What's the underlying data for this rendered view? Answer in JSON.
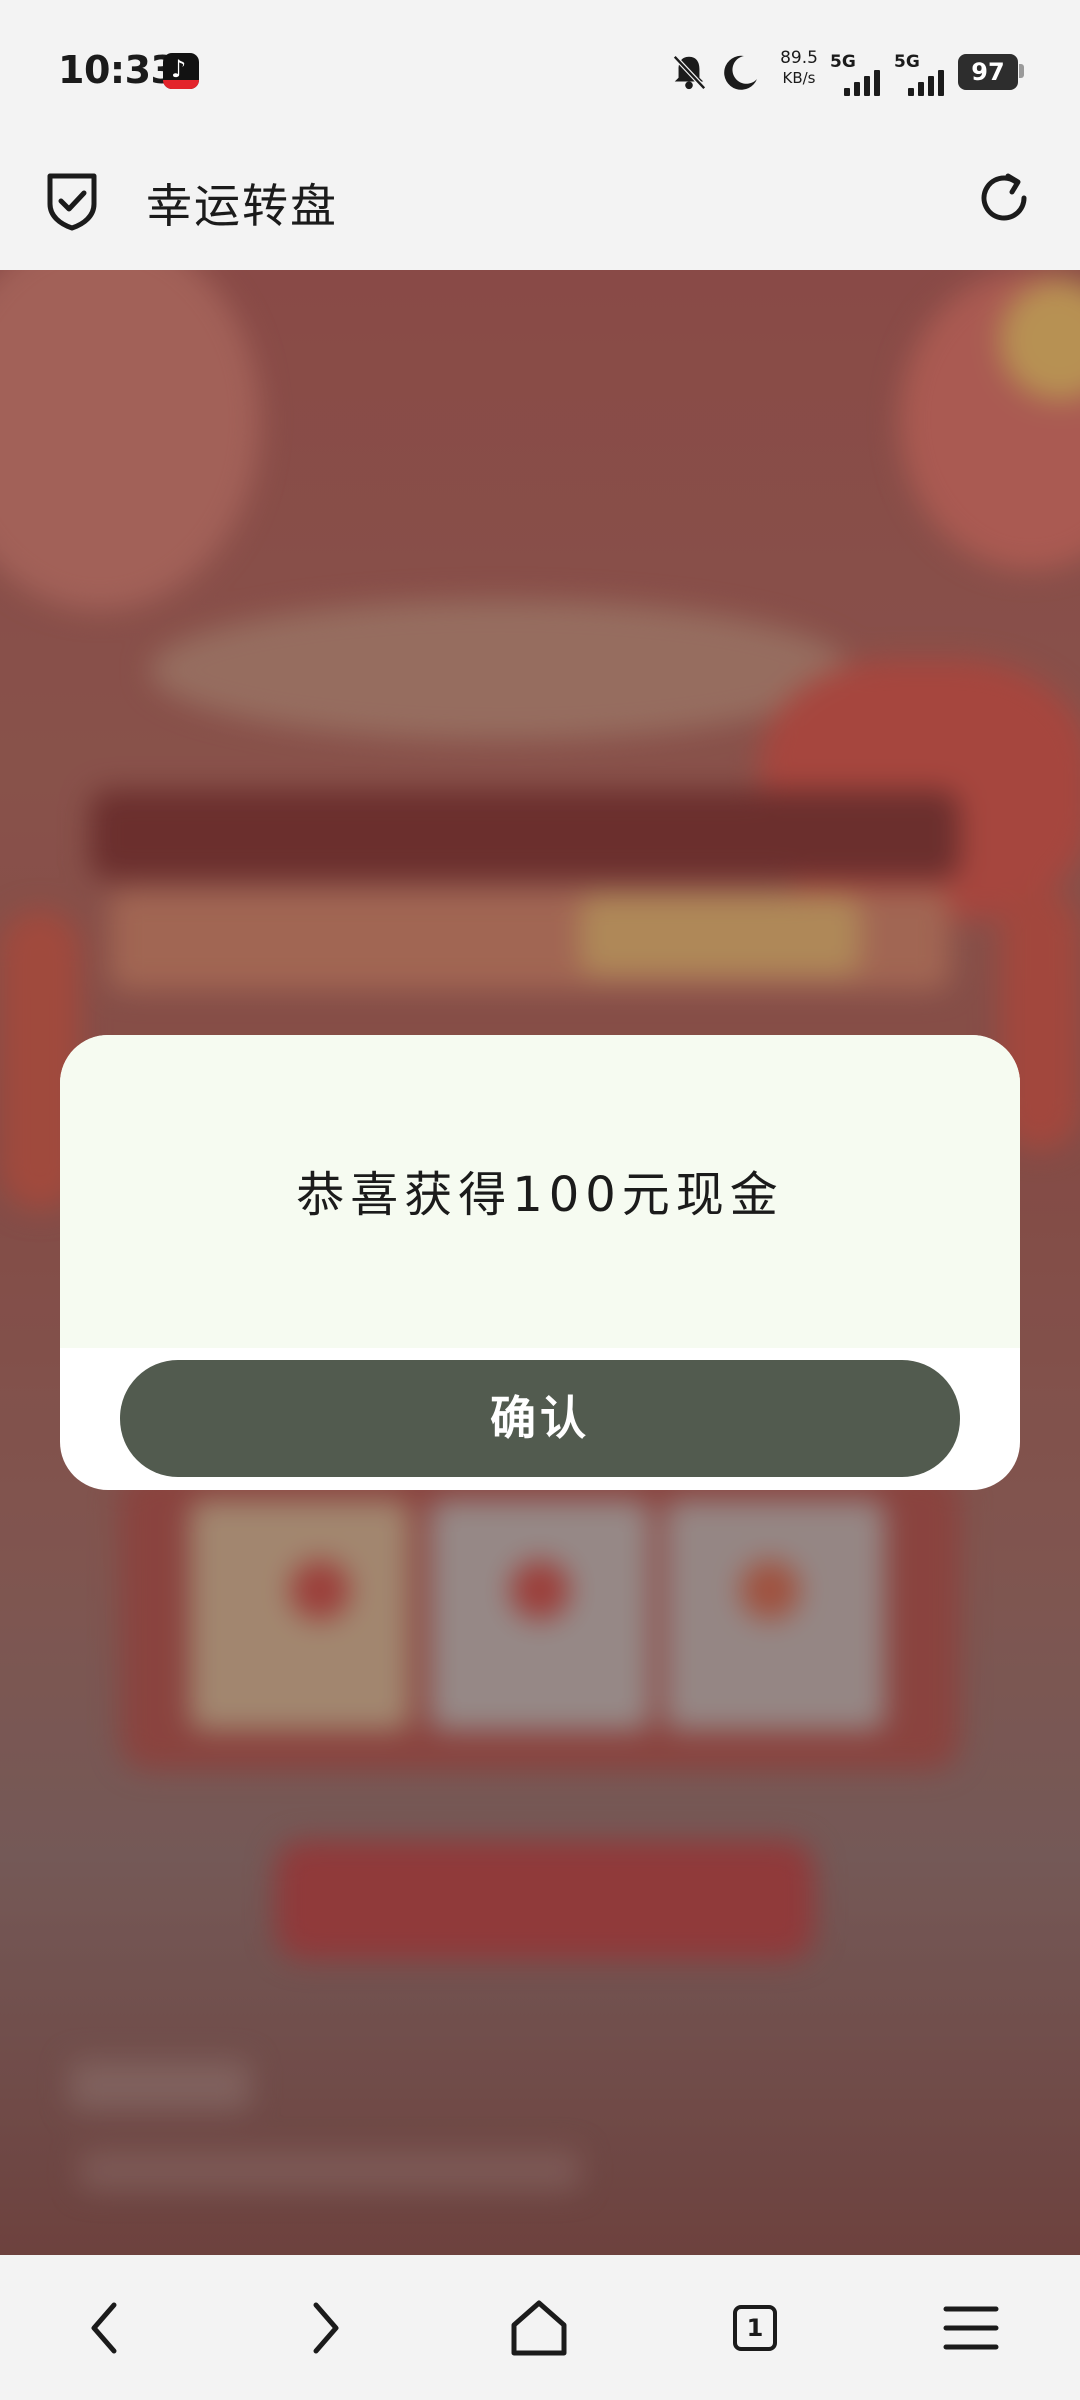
{
  "status_bar": {
    "time": "10:33",
    "net_speed_value": "89.5",
    "net_speed_unit": "KB/s",
    "signal_1_label": "5G",
    "signal_2_label": "5G",
    "battery": "97",
    "icons": [
      "tiktok-app-icon",
      "bell-muted-icon",
      "moon-icon"
    ]
  },
  "header": {
    "title": "幸运转盘",
    "left_icon": "shield-check-icon",
    "right_icon": "refresh-icon"
  },
  "dialog": {
    "message": "恭喜获得100元现金",
    "confirm_label": "确认",
    "colors": {
      "top_bg": "#f6fbf1",
      "button_bg": "#525b4f",
      "button_text": "#ffffff"
    }
  },
  "bottom_nav": {
    "items": [
      "back-icon",
      "forward-icon",
      "home-icon",
      "tabs-icon",
      "menu-icon"
    ],
    "tab_count": "1"
  }
}
